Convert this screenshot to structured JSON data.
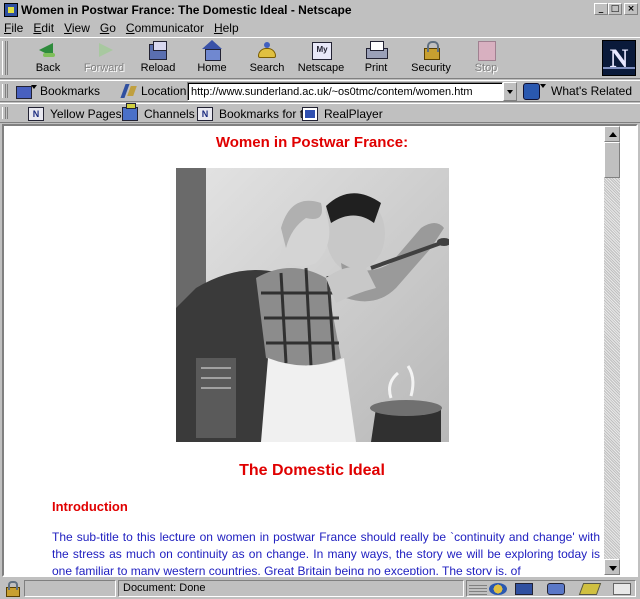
{
  "window": {
    "title": "Women in Postwar France: The Domestic Ideal - Netscape"
  },
  "menu": [
    {
      "pre": "",
      "key": "F",
      "post": "ile"
    },
    {
      "pre": "",
      "key": "E",
      "post": "dit"
    },
    {
      "pre": "",
      "key": "V",
      "post": "iew"
    },
    {
      "pre": "",
      "key": "G",
      "post": "o"
    },
    {
      "pre": "",
      "key": "C",
      "post": "ommunicator"
    },
    {
      "pre": "",
      "key": "H",
      "post": "elp"
    }
  ],
  "toolbar": {
    "back": "Back",
    "forward": "Forward",
    "reload": "Reload",
    "home": "Home",
    "search": "Search",
    "netscape": "Netscape",
    "print": "Print",
    "security": "Security",
    "stop": "Stop"
  },
  "location": {
    "bookmarks_label": "Bookmarks",
    "label": "Location:",
    "url": "http://www.sunderland.ac.uk/~os0tmc/contem/women.htm",
    "whats_related": "What's Related"
  },
  "personal_toolbar": {
    "yellow_pages": "Yellow Pages",
    "channels": "Channels",
    "bookmarks_for": "Bookmarks for t",
    "realplayer": "RealPlayer"
  },
  "page": {
    "heading": "Women in Postwar France:",
    "subheading": "The Domestic Ideal",
    "section_title": "Introduction",
    "intro": "The sub-title to this lecture on women in postwar France should really be `continuity and change' with the stress as much on continuity as on change. In many ways, the story we will be exploring today is one familiar to many western countries, Great Britain being no exception. The story is, of"
  },
  "status": {
    "text": "Document: Done"
  },
  "colors": {
    "heading_red": "#e00000",
    "body_blue": "#2020c0",
    "chrome_gray": "#c0c0c0"
  },
  "icons": {
    "back": "back-arrow-icon",
    "forward": "forward-arrow-icon",
    "reload": "reload-icon",
    "home": "home-icon",
    "search": "search-icon",
    "netscape": "my-netscape-icon",
    "print": "printer-icon",
    "security": "padlock-icon",
    "stop": "stop-icon"
  }
}
